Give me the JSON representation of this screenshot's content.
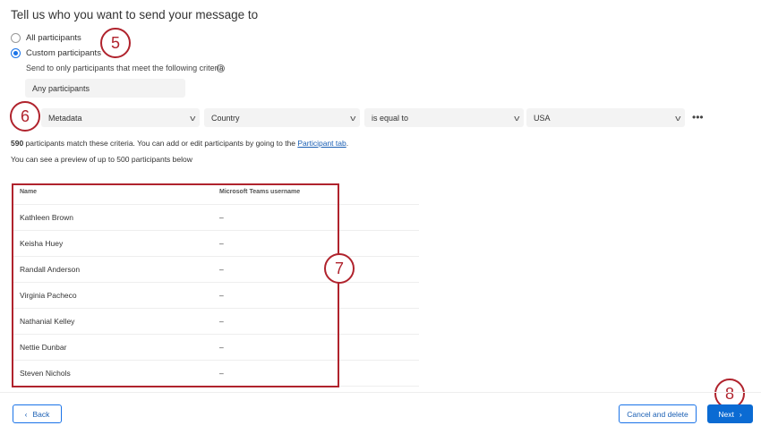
{
  "title": "Tell us who you want to send your message to",
  "options": {
    "all": "All participants",
    "custom": "Custom participants"
  },
  "criteria_text": "Send to only participants that meet the following criteria",
  "info_icon": "i",
  "match_box": "Any participants",
  "filter": {
    "field_type": "Metadata",
    "field": "Country",
    "operator": "is equal to",
    "value": "USA",
    "more": "•••"
  },
  "summary": {
    "count": "590",
    "text": " participants match these criteria. You can add or edit participants by going to the ",
    "link": "Participant tab",
    "end": "."
  },
  "preview_text": "You can see a preview of up to 500 participants below",
  "table": {
    "headers": [
      "Name",
      "Microsoft Teams username"
    ],
    "rows": [
      [
        "Kathleen Brown",
        "–"
      ],
      [
        "Keisha Huey",
        "–"
      ],
      [
        "Randall Anderson",
        "–"
      ],
      [
        "Virginia Pacheco",
        "–"
      ],
      [
        "Nathanial Kelley",
        "–"
      ],
      [
        "Nettie Dunbar",
        "–"
      ],
      [
        "Steven Nichols",
        "–"
      ]
    ]
  },
  "callouts": [
    "5",
    "6",
    "7",
    "8"
  ],
  "buttons": {
    "back": "Back",
    "cancel": "Cancel and delete",
    "next": "Next"
  },
  "colors": {
    "accent": "#0b6bd3",
    "callout": "#b0232d"
  }
}
